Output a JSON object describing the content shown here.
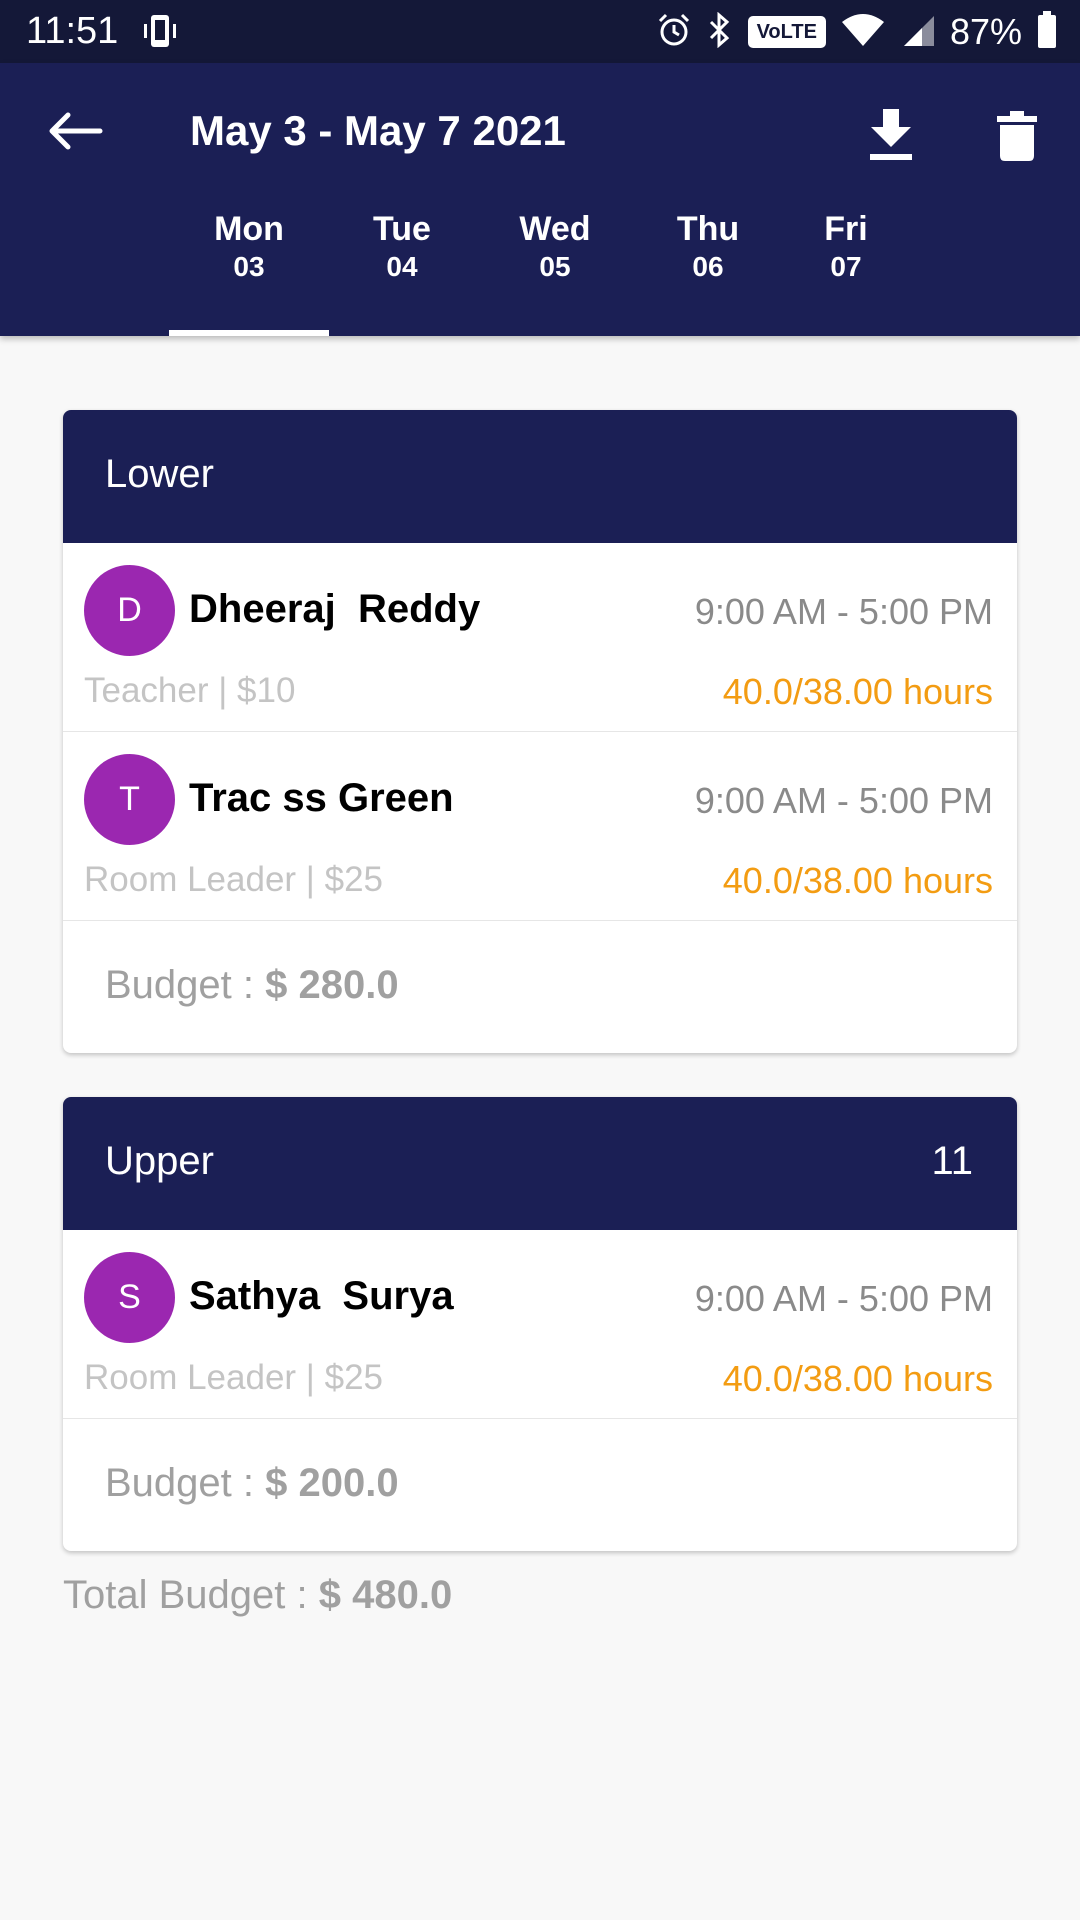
{
  "status_bar": {
    "time": "11:51",
    "volte": "VoLTE",
    "battery": "87%"
  },
  "header": {
    "title": "May 3 - May 7 2021",
    "days": [
      {
        "name": "Mon",
        "date": "03"
      },
      {
        "name": "Tue",
        "date": "04"
      },
      {
        "name": "Wed",
        "date": "05"
      },
      {
        "name": "Thu",
        "date": "06"
      },
      {
        "name": "Fri",
        "date": "07"
      }
    ],
    "selected_day": "Mon"
  },
  "rooms": [
    {
      "name": "Lower",
      "count": "",
      "staff": [
        {
          "initial": "D",
          "name": "Dheeraj  Reddy",
          "time": "9:00 AM - 5:00 PM",
          "role": "Teacher | $10",
          "hours": "40.0/38.00 hours"
        },
        {
          "initial": "T",
          "name": "Trac ss Green",
          "time": "9:00 AM - 5:00 PM",
          "role": "Room Leader | $25",
          "hours": "40.0/38.00 hours"
        }
      ],
      "budget_label": "Budget : ",
      "budget_value": "$ 280.0"
    },
    {
      "name": "Upper",
      "count": "11",
      "staff": [
        {
          "initial": "S",
          "name": "Sathya  Surya",
          "time": "9:00 AM - 5:00 PM",
          "role": "Room Leader | $25",
          "hours": "40.0/38.00 hours"
        }
      ],
      "budget_label": "Budget : ",
      "budget_value": "$ 200.0"
    }
  ],
  "total": {
    "label": "Total Budget : ",
    "value": "$ 480.0"
  },
  "colors": {
    "primary": "#1b1f55",
    "avatar": "#9b27b0",
    "hours": "#f39c12"
  }
}
